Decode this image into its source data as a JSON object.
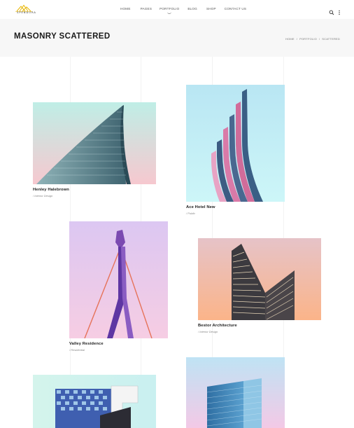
{
  "header": {
    "logo_text": "SPENDORA",
    "nav": [
      {
        "label": "HOME"
      },
      {
        "label": "PAGES"
      },
      {
        "label": "PORTFOLIO"
      },
      {
        "label": "BLOG"
      },
      {
        "label": "SHOP"
      },
      {
        "label": "CONTACT US"
      }
    ],
    "active_nav": "PORTFOLIO",
    "icons": [
      "search-icon",
      "more-vertical-icon"
    ]
  },
  "titlebar": {
    "title": "MASONRY SCATTERED",
    "breadcrumb": [
      "HOME",
      "/",
      "PORTFOLIO",
      "/",
      "SCATTERED"
    ]
  },
  "portfolio": [
    {
      "title": "Henley Halebrown",
      "category": "/ Interior Design"
    },
    {
      "title": "Ace Hotel New",
      "category": "/ Public"
    },
    {
      "title": "Valley Residence",
      "category": "/ Residential"
    },
    {
      "title": "Bestor Architecture",
      "category": "/ Interior Design"
    },
    {
      "title": "",
      "category": ""
    },
    {
      "title": "",
      "category": ""
    }
  ],
  "colors": {
    "accent_logo": "#e8b600",
    "titlebar_bg": "#f7f7f7"
  }
}
